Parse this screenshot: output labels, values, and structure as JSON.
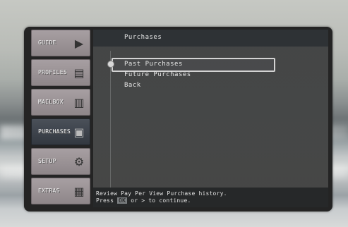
{
  "menu": {
    "tabs": [
      {
        "label": "GUIDE",
        "icon": "arrow-right-icon",
        "active": false
      },
      {
        "label": "PROFILES",
        "icon": "notepad-icon",
        "active": false
      },
      {
        "label": "MAILBOX",
        "icon": "mailbox-icon",
        "active": false
      },
      {
        "label": "PURCHASES",
        "icon": "register-icon",
        "active": true
      },
      {
        "label": "SETUP",
        "icon": "gears-icon",
        "active": false
      },
      {
        "label": "EXTRAS",
        "icon": "grid-icon",
        "active": false
      }
    ]
  },
  "panel": {
    "title": "Purchases",
    "items": [
      "Past Purchases",
      "Future Purchases",
      "Back"
    ],
    "selected_index": 0
  },
  "help": {
    "line1": "Review Pay Per View Purchase history.",
    "line2_prefix": "Press",
    "line2_key": "OK",
    "line2_suffix": "or > to continue."
  }
}
